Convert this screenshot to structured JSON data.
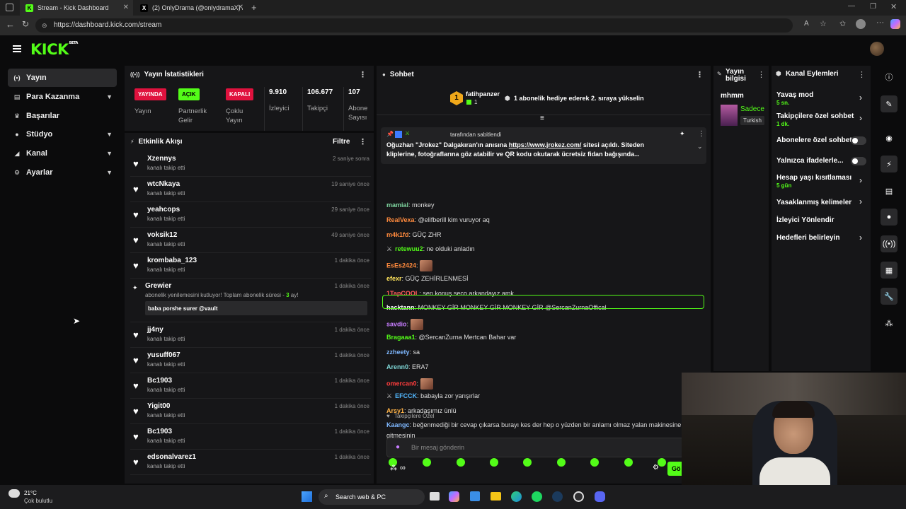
{
  "browser": {
    "tabs": [
      {
        "title": "Stream - Kick Dashboard",
        "favicon": "K"
      },
      {
        "title": "(2) OnlyDrama (@onlydramaX) / X",
        "favicon": "X"
      }
    ],
    "url": "https://dashboard.kick.com/stream"
  },
  "app": {
    "logo": "KICK",
    "logo_tag": "BETA"
  },
  "sidebar": {
    "items": [
      {
        "label": "Yayın",
        "icon": "broadcast-icon",
        "active": true,
        "expandable": false
      },
      {
        "label": "Para Kazanma",
        "icon": "money-icon",
        "active": false,
        "expandable": true
      },
      {
        "label": "Başarılar",
        "icon": "trophy-icon",
        "active": false,
        "expandable": false
      },
      {
        "label": "Stüdyo",
        "icon": "studio-icon",
        "active": false,
        "expandable": true
      },
      {
        "label": "Kanal",
        "icon": "channel-icon",
        "active": false,
        "expandable": true
      },
      {
        "label": "Ayarlar",
        "icon": "settings-icon",
        "active": false,
        "expandable": true
      }
    ]
  },
  "stats": {
    "title": "Yayın İstatistikleri",
    "items": [
      {
        "badge": "YAYINDA",
        "badge_color": "#e0123e",
        "label": "Yayın"
      },
      {
        "badge": "AÇIK",
        "badge_color": "#53fc18",
        "label": "Partnerlik Gelir"
      },
      {
        "badge": "KAPALI",
        "badge_color": "#e0123e",
        "label": "Çoklu Yayın"
      },
      {
        "value": "9.910",
        "label": "İzleyici"
      },
      {
        "value": "106.677",
        "label": "Takipçi"
      },
      {
        "value": "107",
        "label": "Abone Sayısı"
      }
    ]
  },
  "activity": {
    "title": "Etkinlik Akışı",
    "filter_label": "Filtre",
    "rows": [
      {
        "user": "Xzennys",
        "desc": "kanalı takip etti",
        "time": "2 saniye sonra"
      },
      {
        "user": "wtcNkaya",
        "desc": "kanalı takip etti",
        "time": "19 saniye önce"
      },
      {
        "user": "yeahcops",
        "desc": "kanalı takip etti",
        "time": "29 saniye önce"
      },
      {
        "user": "voksik12",
        "desc": "kanalı takip etti",
        "time": "49 saniye önce"
      },
      {
        "user": "krombaba_123",
        "desc": "kanalı takip etti",
        "time": "1 dakika önce"
      }
    ],
    "sub_event": {
      "user": "Grewier",
      "time": "1 dakika önce",
      "desc_prefix": "abonelik yenilemesini kutluyor! Toplam abonelik süresi - ",
      "months": "3",
      "desc_suffix": " ay!",
      "message": "baba porshe surer @vault"
    },
    "rows2": [
      {
        "user": "jj4ny",
        "desc": "kanalı takip etti",
        "time": "1 dakika önce"
      },
      {
        "user": "yusuff067",
        "desc": "kanalı takip etti",
        "time": "1 dakika önce"
      },
      {
        "user": "Bc1903",
        "desc": "kanalı takip etti",
        "time": "1 dakika önce"
      },
      {
        "user": "Yigit00",
        "desc": "kanalı takip etti",
        "time": "1 dakika önce"
      },
      {
        "user": "Bc1903",
        "desc": "kanalı takip etti",
        "time": "1 dakika önce"
      },
      {
        "user": "edsonalvarez1",
        "desc": "kanalı takip etti",
        "time": "1 dakika önce"
      }
    ]
  },
  "chat": {
    "title": "Sohbet",
    "top_gifter": {
      "rank": "1",
      "name": "fatihpanzer",
      "count": "1",
      "text": "1 abonelik hediye ederek 2. sıraya yükselin"
    },
    "pinned": {
      "by": "tarafından sabitlendi",
      "text": "Oğuzhan \"Jrokez\" Dalgakıran'ın anısına ",
      "link": "https://www.jrokez.com/",
      "text2": " sitesi açıldı. Siteden kliplerine, fotoğraflarına göz atabilir ve QR kodu okutarak ücretsiz fidan bağışında..."
    },
    "messages": [
      {
        "user": "mamial",
        "color": "#7fd6a0",
        "text": "monkey"
      },
      {
        "user": "RealVexa",
        "color": "#ff8a3d",
        "text": "@elifberill kim vuruyor aq"
      },
      {
        "user": "m4k1fd",
        "color": "#ff8a3d",
        "text": "GÜÇ ZHR"
      },
      {
        "user": "retewuu2",
        "color": "#53fc18",
        "text": "ne olduki anladın"
      },
      {
        "user": "EsEs2424",
        "color": "#ff8a3d",
        "text": ""
      },
      {
        "user": "efexr",
        "color": "#ffe45c",
        "text": "GÜÇ ZEHİRLENMESİ"
      },
      {
        "user": "1TapCOOL",
        "color": "#ff5a5a",
        "text": "sen konuş seco arkandayız amk"
      },
      {
        "user": "hacktann",
        "color": "#ffffff",
        "text": "MONKEY GİR MONKEY GİR MONKEY GİR @SercanZurnaOffical"
      },
      {
        "user": "savdio",
        "color": "#c77dff",
        "text": ""
      },
      {
        "user": "Bragaaa1",
        "color": "#53fc18",
        "text": "@SercanZurna Mertcan Bahar var"
      },
      {
        "user": "zzheety",
        "color": "#7fb8ff",
        "text": "sa"
      },
      {
        "user": "Arenn0",
        "color": "#7fd6d6",
        "text": "ERA7"
      },
      {
        "user": "omercan0",
        "color": "#ff3d3d",
        "text": ""
      },
      {
        "user": "EFCCK",
        "color": "#53b8ff",
        "text": "babayla zor yarışırlar"
      },
      {
        "user": "Arsy1",
        "color": "#ffb347",
        "text": "arkadaşımız ünlü"
      },
      {
        "user": "Kaangc",
        "color": "#7fb8ff",
        "text": "beğenmediği bir cevap çıkarsa burayı kes der hep o yüzden bir anlamı olmaz yalan makinesine"
      },
      {
        "user": "",
        "color": "#ffffff",
        "text": "gitmesinin"
      }
    ],
    "followers_only": "Takipçilere Özel",
    "input_placeholder": "Bir mesaj gönderin",
    "send_label": "Gö"
  },
  "stream_info": {
    "title": "Yayın bilgisi",
    "name": "mhmm",
    "sub": "Sadece",
    "tag": "Turkish"
  },
  "channel_actions": {
    "title": "Kanal Eylemleri",
    "items": [
      {
        "label": "Yavaş mod",
        "sub": "5 sn.",
        "control": "arrow"
      },
      {
        "label": "Takipçilere özel sohbet",
        "sub": "1 dk.",
        "control": "arrow"
      },
      {
        "label": "Abonelere özel sohbet",
        "sub": "",
        "control": "toggle"
      },
      {
        "label": "Yalnızca ifadelerle...",
        "sub": "",
        "control": "toggle"
      },
      {
        "label": "Hesap yaşı kısıtlaması",
        "sub": "5 gün",
        "control": "arrow"
      },
      {
        "label": "Yasaklanmış kelimeler",
        "sub": "",
        "control": "arrow"
      },
      {
        "label": "İzleyici Yönlendir",
        "sub": "",
        "control": "none"
      },
      {
        "label": "Hedefleri belirleyin",
        "sub": "",
        "control": "arrow"
      }
    ]
  },
  "taskbar": {
    "weather_temp": "21°C",
    "weather_desc": "Çok bulutlu",
    "search_placeholder": "Search web & PC"
  },
  "colors": {
    "accent": "#53fc18",
    "panel": "#161618",
    "bg": "#0b0b0c",
    "live": "#e0123e"
  }
}
